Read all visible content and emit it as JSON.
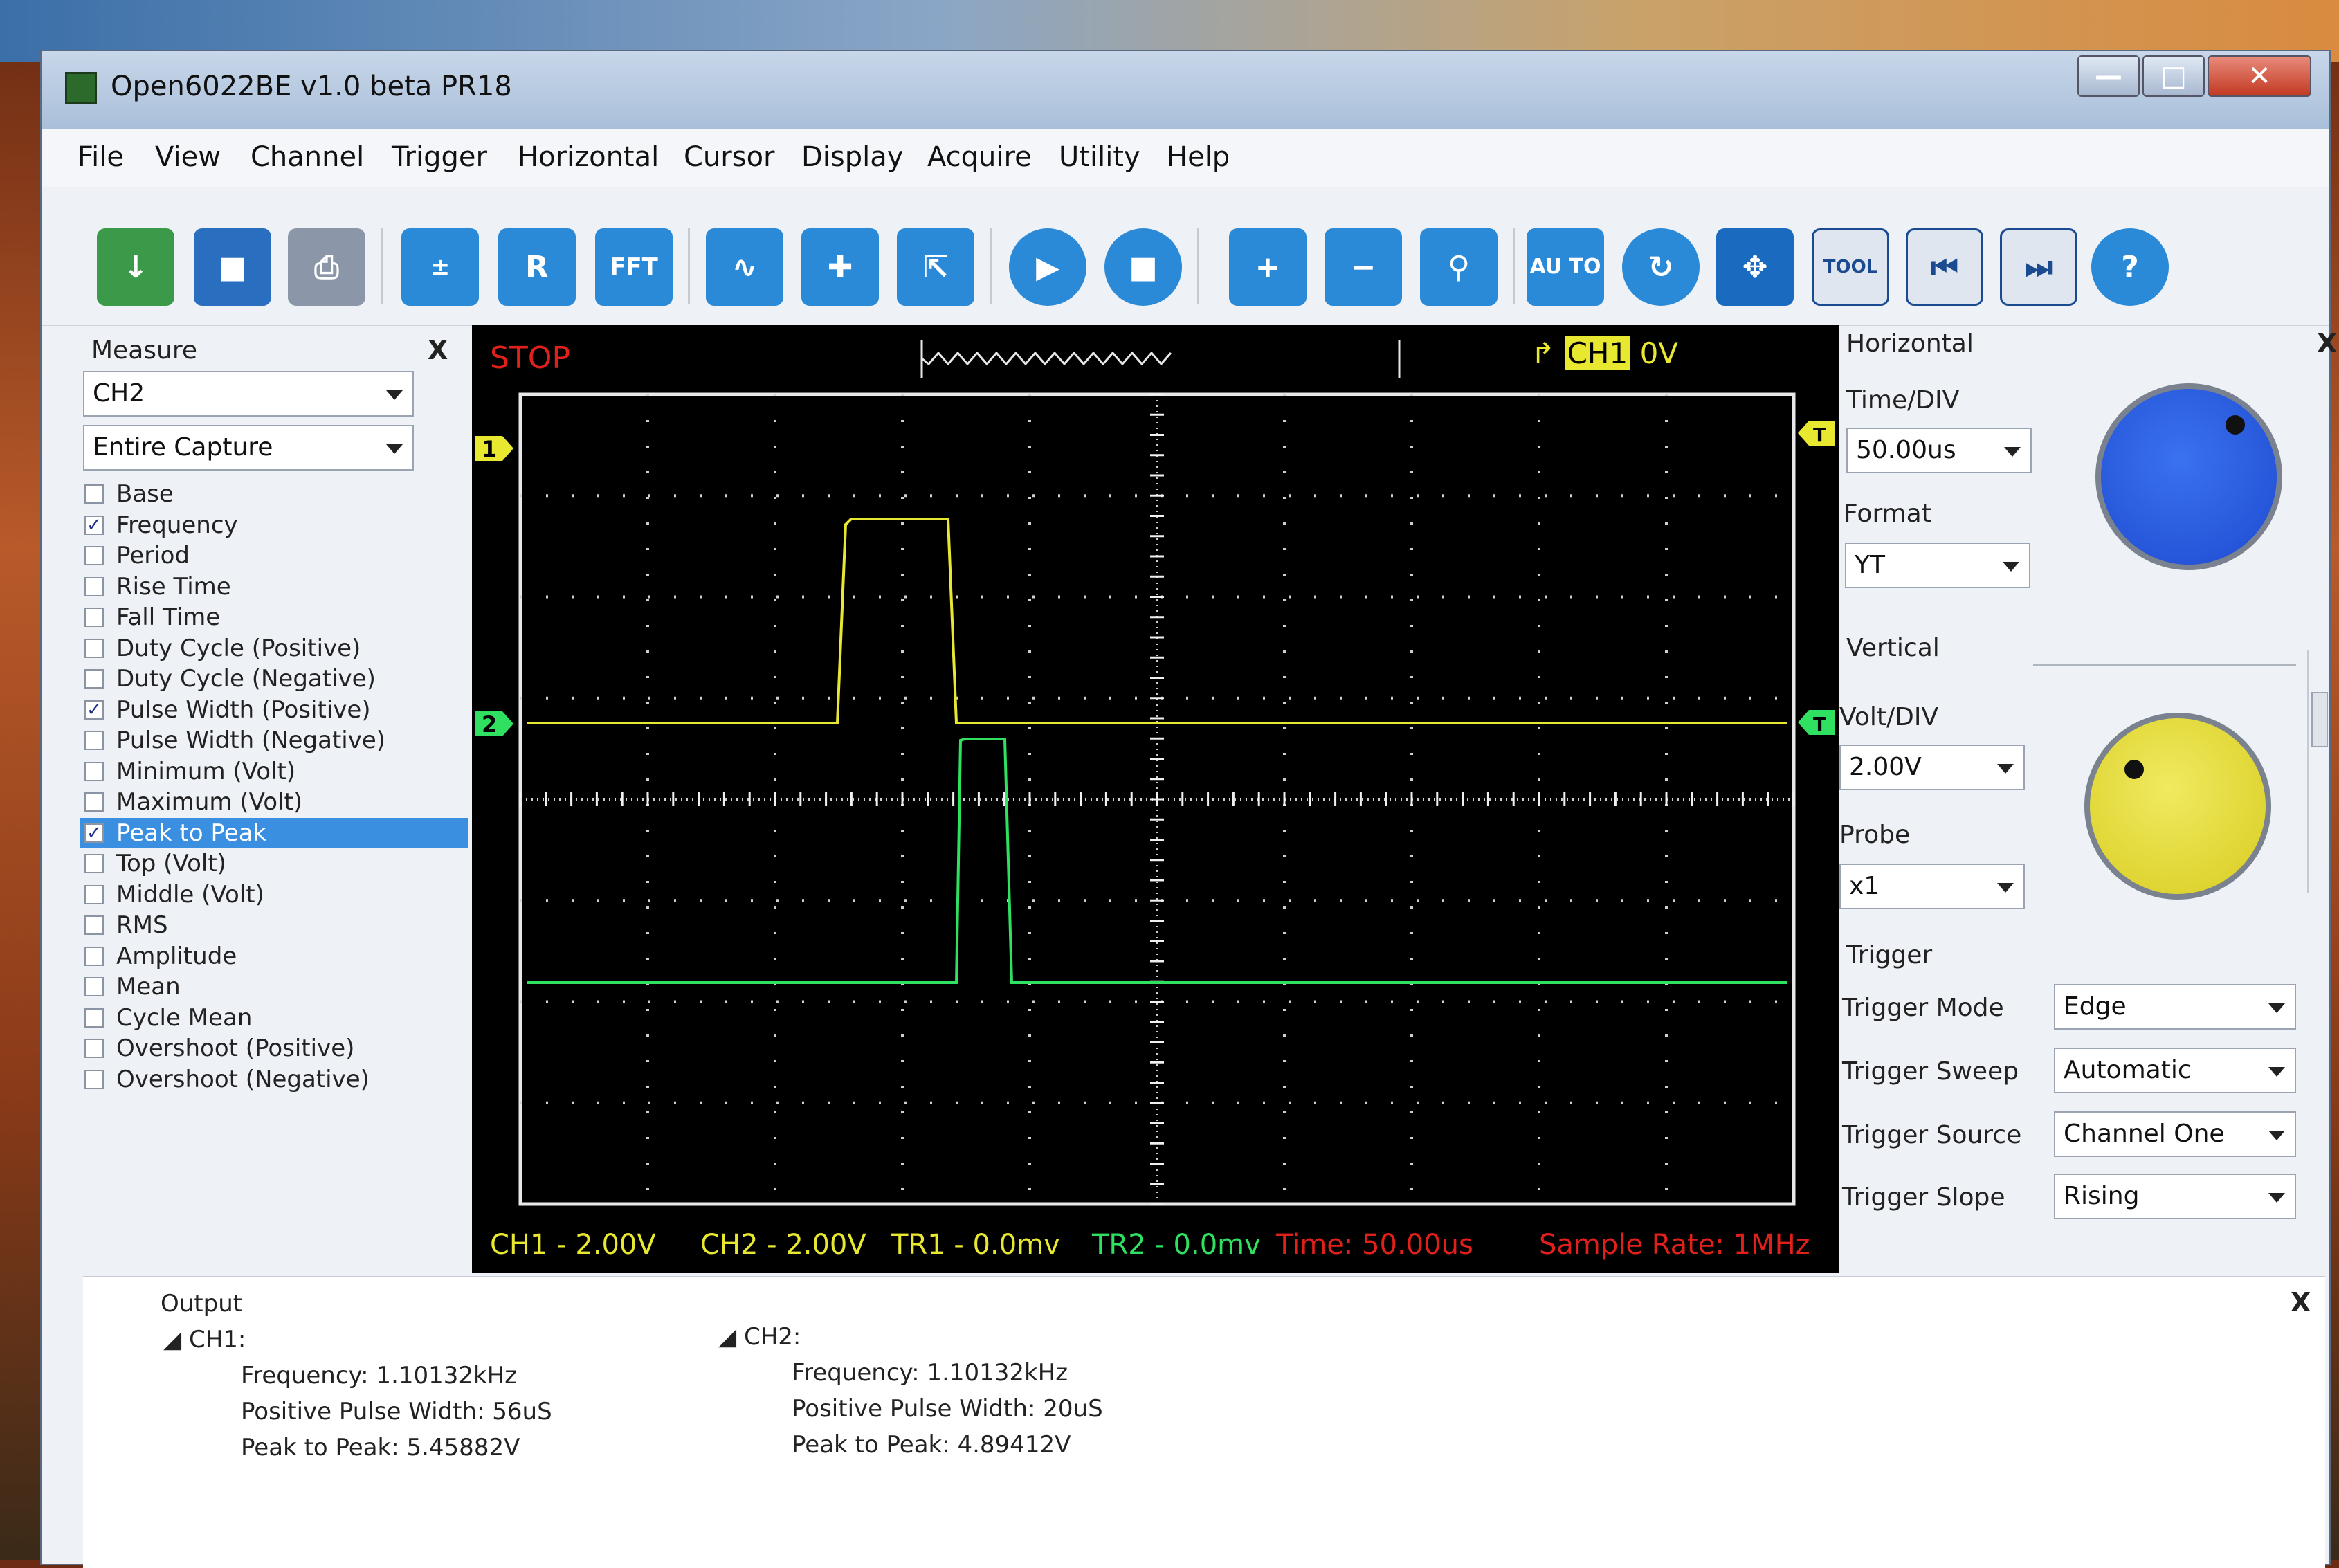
{
  "window": {
    "title": "Open6022BE v1.0 beta PR18"
  },
  "menu": [
    "File",
    "View",
    "Channel",
    "Trigger",
    "Horizontal",
    "Cursor",
    "Display",
    "Acquire",
    "Utility",
    "Help"
  ],
  "toolbar_icons": [
    "load-icon",
    "save-icon",
    "print-icon",
    "math-icon",
    "reference-icon",
    "fft-icon",
    "waveform-icon",
    "cursor-icon",
    "measure-icon",
    "run-icon",
    "stop-icon",
    "zoom-in-icon",
    "zoom-out-icon",
    "zoom-fit-icon",
    "autoset-icon",
    "refresh-icon",
    "fullscreen-icon",
    "tool-icon",
    "prev-frame-icon",
    "next-frame-icon",
    "help-icon"
  ],
  "toolbar_labels": {
    "reference": "R",
    "fft": "FFT",
    "autoset": "AU TO",
    "tool": "TOOL",
    "help": "?"
  },
  "measure": {
    "title": "Measure",
    "close": "X",
    "channel": "CH2",
    "range": "Entire Capture",
    "items": [
      {
        "label": "Base",
        "checked": false
      },
      {
        "label": "Frequency",
        "checked": true
      },
      {
        "label": "Period",
        "checked": false
      },
      {
        "label": "Rise Time",
        "checked": false
      },
      {
        "label": "Fall Time",
        "checked": false
      },
      {
        "label": "Duty Cycle (Positive)",
        "checked": false
      },
      {
        "label": "Duty Cycle (Negative)",
        "checked": false
      },
      {
        "label": "Pulse Width (Positive)",
        "checked": true
      },
      {
        "label": "Pulse Width (Negative)",
        "checked": false
      },
      {
        "label": "Minimum (Volt)",
        "checked": false
      },
      {
        "label": "Maximum (Volt)",
        "checked": false
      },
      {
        "label": "Peak to Peak",
        "checked": true,
        "selected": true
      },
      {
        "label": "Top (Volt)",
        "checked": false
      },
      {
        "label": "Middle (Volt)",
        "checked": false
      },
      {
        "label": "RMS",
        "checked": false
      },
      {
        "label": "Amplitude",
        "checked": false
      },
      {
        "label": "Mean",
        "checked": false
      },
      {
        "label": "Cycle Mean",
        "checked": false
      },
      {
        "label": "Overshoot (Positive)",
        "checked": false
      },
      {
        "label": "Overshoot (Negative)",
        "checked": false
      }
    ]
  },
  "scope": {
    "status": "STOP",
    "trigger_channel": "CH1",
    "trigger_level": "0V",
    "marker_ch1": "1",
    "marker_ch2": "2",
    "marker_trigger": "T",
    "readouts": {
      "ch1": "CH1 - 2.00V",
      "ch2": "CH2 - 2.00V",
      "tr1": "TR1 - 0.0mv",
      "tr2": "TR2 - 0.0mv",
      "time": "Time: 50.00us",
      "sample_rate": "Sample Rate: 1MHz"
    },
    "colors": {
      "ch1": "#e8e830",
      "ch2": "#30e060",
      "status": "#e0201a",
      "grid": "#d0d0d0"
    }
  },
  "horizontal": {
    "title": "Horizontal",
    "close": "X",
    "time_div_label": "Time/DIV",
    "time_div": "50.00us",
    "format_label": "Format",
    "format": "YT"
  },
  "vertical": {
    "title": "Vertical",
    "volt_div_label": "Volt/DIV",
    "volt_div": "2.00V",
    "probe_label": "Probe",
    "probe": "x1"
  },
  "trigger": {
    "title": "Trigger",
    "mode_label": "Trigger Mode",
    "mode": "Edge",
    "sweep_label": "Trigger Sweep",
    "sweep": "Automatic",
    "source_label": "Trigger Source",
    "source": "Channel One",
    "slope_label": "Trigger Slope",
    "slope": "Rising"
  },
  "output": {
    "title": "Output",
    "close": "X",
    "ch1": {
      "label": "CH1:",
      "frequency": "Frequency: 1.10132kHz",
      "pulse_width": "Positive Pulse Width: 56uS",
      "peak_to_peak": "Peak to Peak: 5.45882V"
    },
    "ch2": {
      "label": "CH2:",
      "frequency": "Frequency: 1.10132kHz",
      "pulse_width": "Positive Pulse Width: 20uS",
      "peak_to_peak": "Peak to Peak: 4.89412V"
    }
  }
}
